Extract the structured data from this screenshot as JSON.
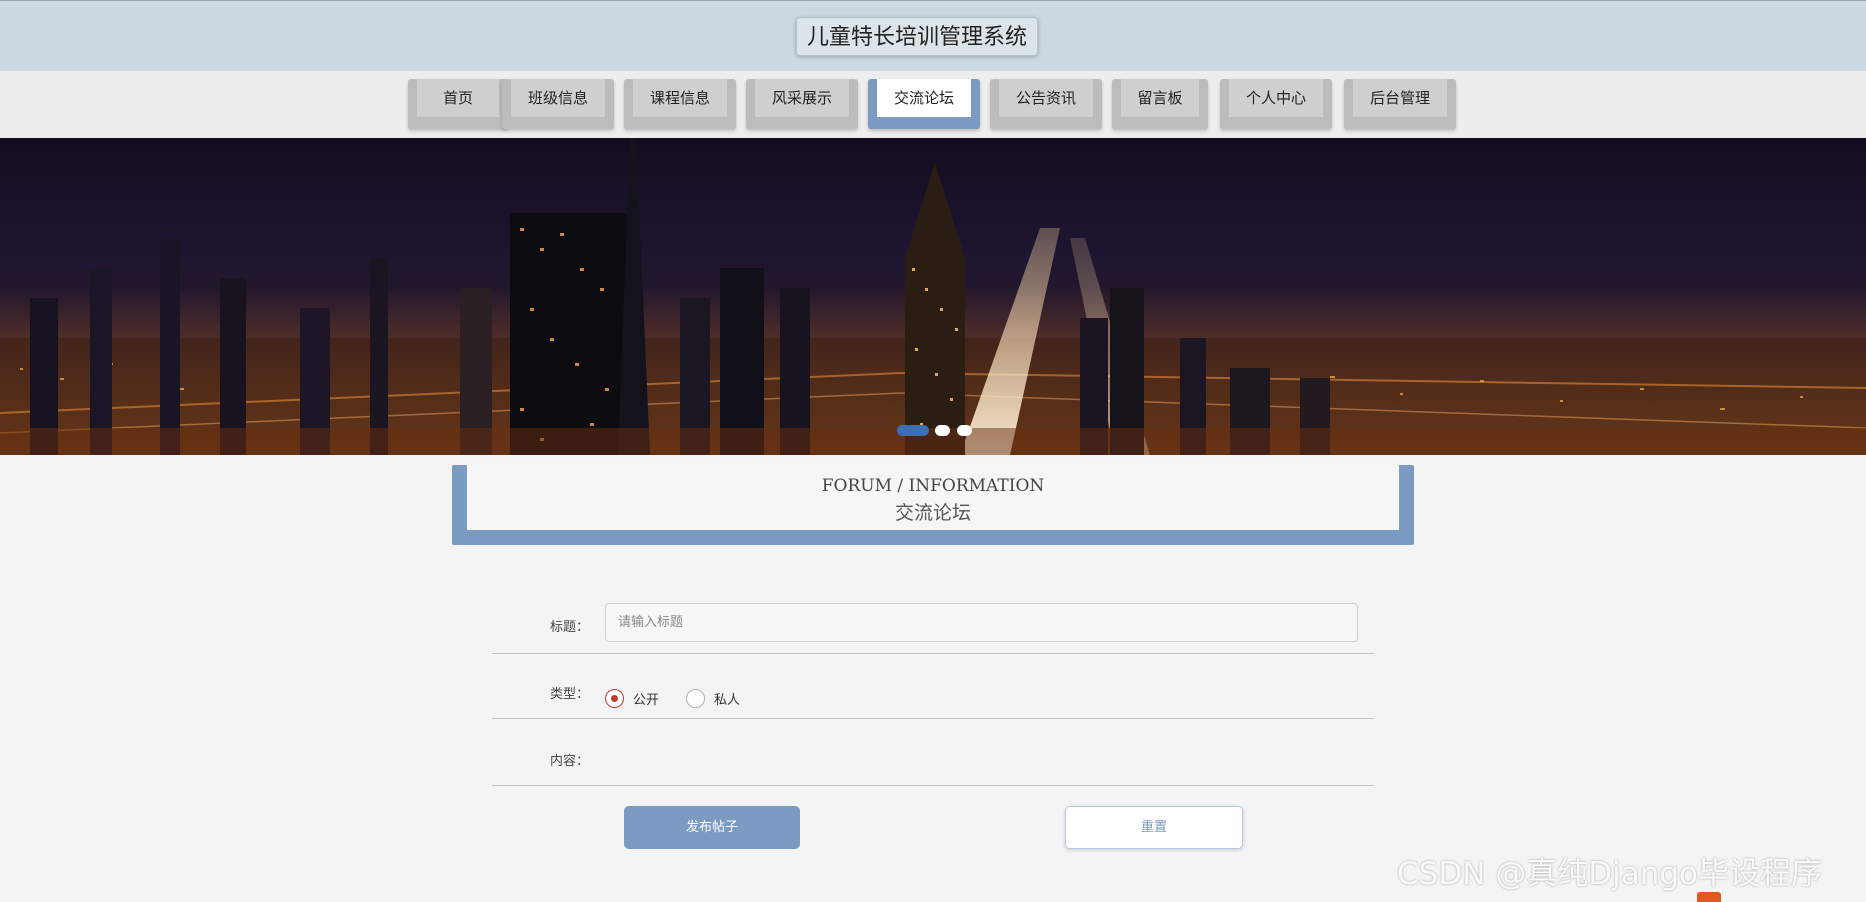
{
  "header": {
    "site_title": "儿童特长培训管理系统"
  },
  "nav": {
    "items": [
      {
        "label": "首页",
        "active": false
      },
      {
        "label": "班级信息",
        "active": false
      },
      {
        "label": "课程信息",
        "active": false
      },
      {
        "label": "风采展示",
        "active": false
      },
      {
        "label": "交流论坛",
        "active": true
      },
      {
        "label": "公告资讯",
        "active": false
      },
      {
        "label": "留言板",
        "active": false
      },
      {
        "label": "个人中心",
        "active": false
      },
      {
        "label": "后台管理",
        "active": false
      }
    ]
  },
  "banner": {
    "carousel_slide_count": 3,
    "active_slide": 1
  },
  "section": {
    "title_en": "FORUM / INFORMATION",
    "title_zh": "交流论坛"
  },
  "form": {
    "title_label": "标题：",
    "title_placeholder": "请输入标题",
    "title_value": "",
    "type_label": "类型：",
    "type_options": [
      {
        "label": "公开",
        "checked": true
      },
      {
        "label": "私人",
        "checked": false
      }
    ],
    "content_label": "内容：",
    "submit_label": "发布帖子",
    "reset_label": "重置"
  },
  "watermark": "CSDN @真纯Django毕设程序",
  "colors": {
    "accent": "#7b9bc2",
    "header_bg": "#cdd8e0",
    "radio_checked": "#c0392b",
    "page_bg": "#f4f4f4"
  }
}
